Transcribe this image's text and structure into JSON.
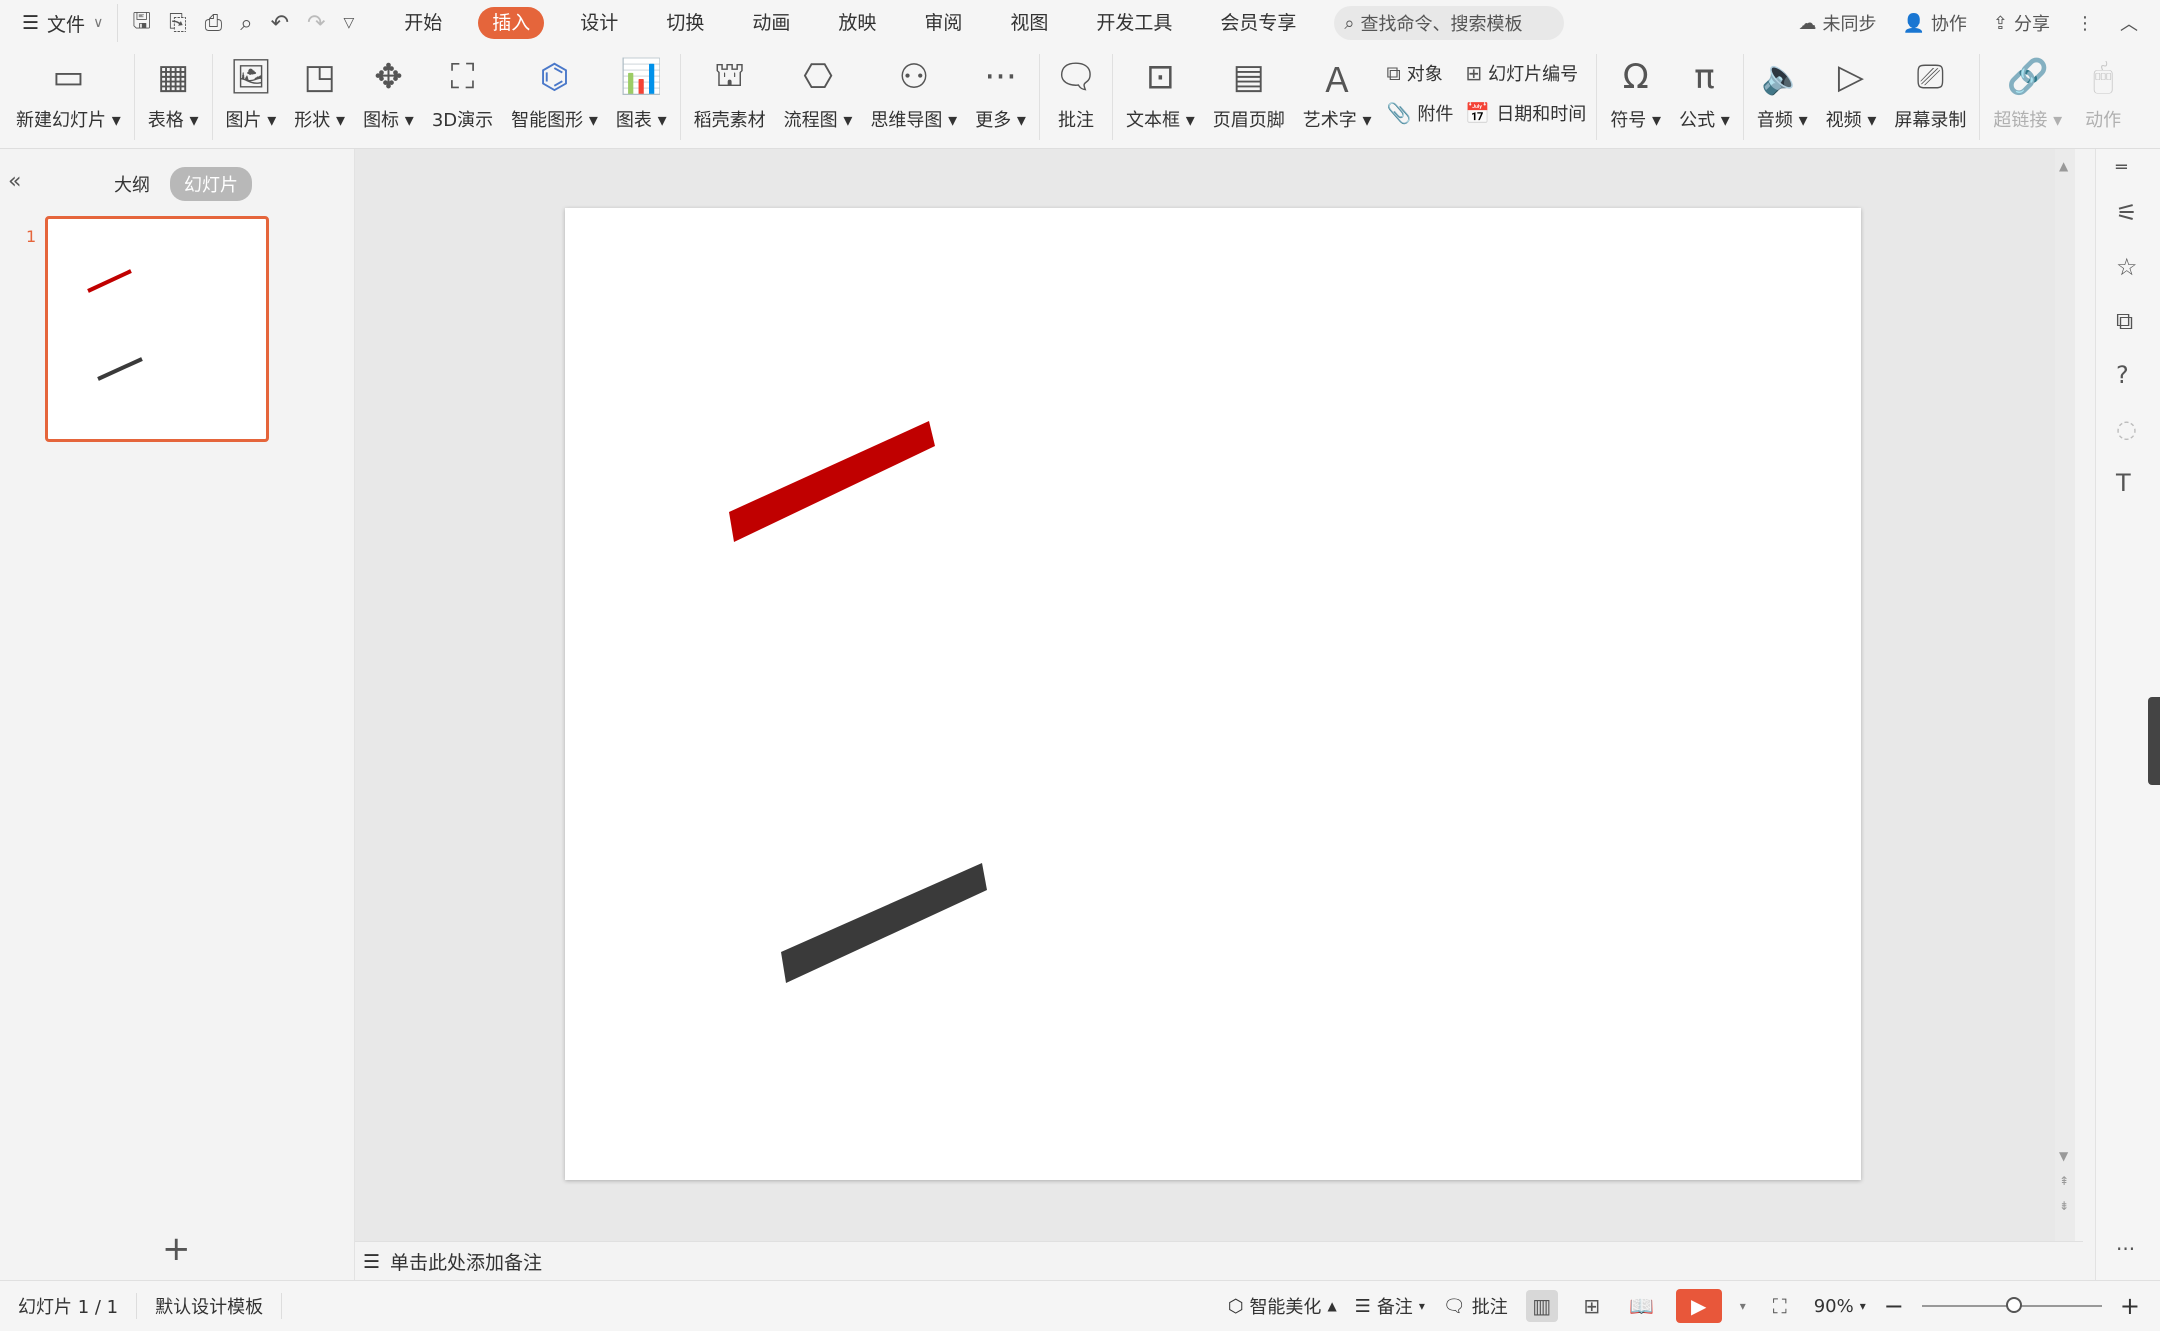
{
  "menu": {
    "file_label": "文件",
    "quick_access_icons": [
      "save-icon",
      "format-painter-icon",
      "print-icon",
      "print-preview-icon",
      "undo-icon",
      "redo-icon",
      "customize-icon"
    ],
    "tabs": [
      {
        "label": "开始",
        "active": false
      },
      {
        "label": "插入",
        "active": true
      },
      {
        "label": "设计",
        "active": false
      },
      {
        "label": "切换",
        "active": false
      },
      {
        "label": "动画",
        "active": false
      },
      {
        "label": "放映",
        "active": false
      },
      {
        "label": "审阅",
        "active": false
      },
      {
        "label": "视图",
        "active": false
      },
      {
        "label": "开发工具",
        "active": false
      },
      {
        "label": "会员专享",
        "active": false
      }
    ],
    "search_placeholder": "查找命令、搜索模板",
    "sync_label": "未同步",
    "collab_label": "协作",
    "share_label": "分享"
  },
  "ribbon": {
    "new_slide": "新建幻灯片",
    "table": "表格",
    "picture": "图片",
    "shape": "形状",
    "icon": "图标",
    "demo3d": "3D演示",
    "smartart": "智能图形",
    "chart": "图表",
    "assets": "稻壳素材",
    "flowchart": "流程图",
    "mindmap": "思维导图",
    "more": "更多",
    "comment": "批注",
    "textbox": "文本框",
    "header_footer": "页眉页脚",
    "wordart": "艺术字",
    "object": "对象",
    "slide_number": "幻灯片编号",
    "attachment": "附件",
    "datetime": "日期和时间",
    "symbol": "符号",
    "formula": "公式",
    "audio": "音频",
    "video": "视频",
    "screen_record": "屏幕录制",
    "hyperlink": "超链接",
    "action": "动作"
  },
  "left_panel": {
    "outline_tab": "大纲",
    "slides_tab": "幻灯片",
    "slide_number": "1"
  },
  "slide": {
    "shapes": [
      {
        "name": "red-bar",
        "color": "#c00000"
      },
      {
        "name": "dark-bar",
        "color": "#3a3a3a"
      }
    ]
  },
  "notes": {
    "placeholder": "单击此处添加备注"
  },
  "status": {
    "slide_count": "幻灯片 1 / 1",
    "template": "默认设计模板",
    "beautify": "智能美化",
    "notes": "备注",
    "comments": "批注",
    "zoom": "90%"
  },
  "colors": {
    "accent": "#e5653b",
    "play": "#e8573a"
  }
}
